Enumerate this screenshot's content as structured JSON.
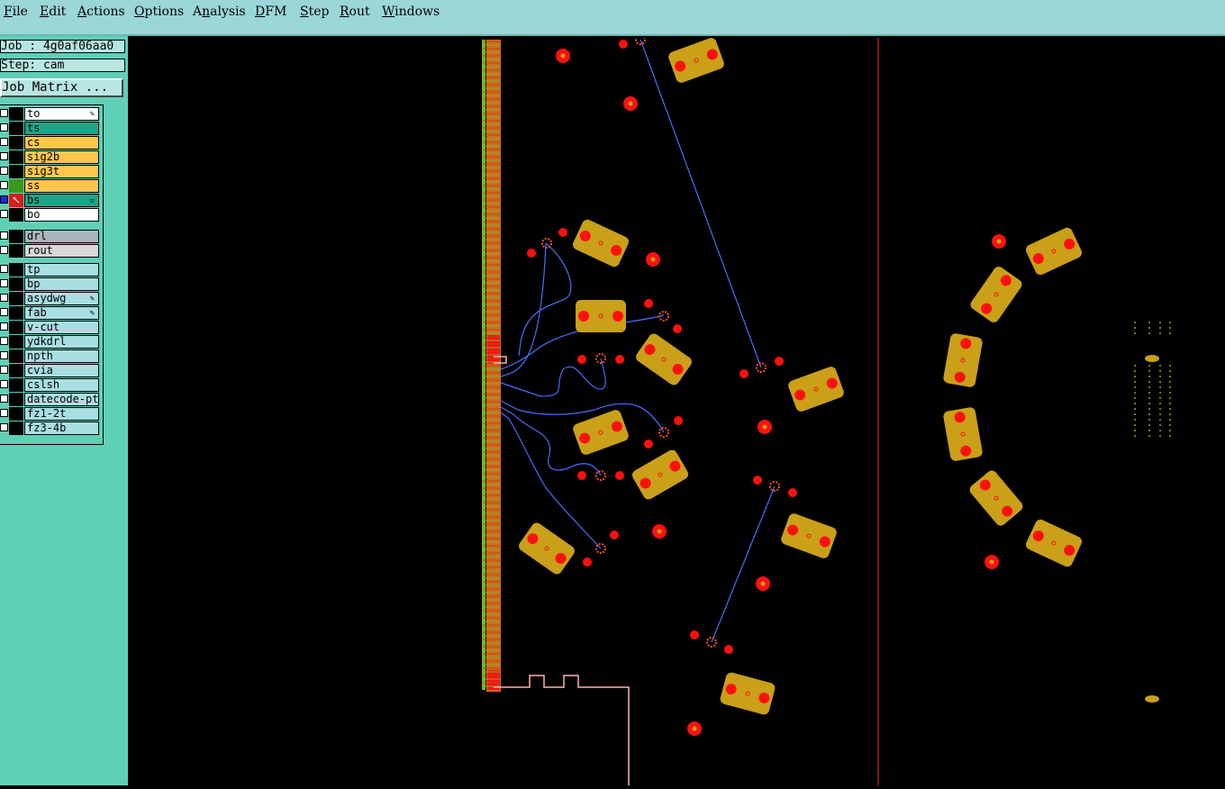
{
  "menu": {
    "items": [
      {
        "label": "File",
        "accel": "F"
      },
      {
        "label": "Edit",
        "accel": "E"
      },
      {
        "label": "Actions",
        "accel": "A"
      },
      {
        "label": "Options",
        "accel": "O"
      },
      {
        "label": "Analysis",
        "accel": "n"
      },
      {
        "label": "DFM",
        "accel": "D"
      },
      {
        "label": "Step",
        "accel": "S"
      },
      {
        "label": "Rout",
        "accel": "R"
      },
      {
        "label": "Windows",
        "accel": "W"
      }
    ]
  },
  "job": {
    "job_text": "Job : 4g0af06aa0",
    "step_text": "Step: cam",
    "matrix_button": "Job Matrix ..."
  },
  "layers": {
    "group1": [
      {
        "name": "to",
        "color": "#ffffff",
        "mark": "✎"
      },
      {
        "name": "ts",
        "color": "#1fa487",
        "mark": ""
      },
      {
        "name": "cs",
        "color": "#ffc64f",
        "mark": ""
      },
      {
        "name": "sig2b",
        "color": "#ffc64f",
        "mark": ""
      },
      {
        "name": "sig3t",
        "color": "#ffc64f",
        "mark": ""
      },
      {
        "name": "ss",
        "color": "#ffc64f",
        "mark": "",
        "indicator": "#3c9a1a"
      },
      {
        "name": "bs",
        "color": "#1fa487",
        "mark": "▫",
        "active": true
      },
      {
        "name": "bo",
        "color": "#ffffff",
        "mark": ""
      }
    ],
    "group2": [
      {
        "name": "drl",
        "color": "#a9b6ba",
        "mark": ""
      },
      {
        "name": "rout",
        "color": "#d8d8d8",
        "mark": ""
      }
    ],
    "group3": [
      {
        "name": "tp",
        "color": "#a8dfe2",
        "mark": ""
      },
      {
        "name": "bp",
        "color": "#a8dfe2",
        "mark": ""
      },
      {
        "name": "asydwg",
        "color": "#a8dfe2",
        "mark": "✎"
      },
      {
        "name": "fab",
        "color": "#a8dfe2",
        "mark": "✎"
      },
      {
        "name": "v-cut",
        "color": "#a8dfe2",
        "mark": ""
      },
      {
        "name": "ydkdrl",
        "color": "#a8dfe2",
        "mark": ""
      },
      {
        "name": "npth",
        "color": "#a8dfe2",
        "mark": ""
      },
      {
        "name": "cvia",
        "color": "#a8dfe2",
        "mark": ""
      },
      {
        "name": "cslsh",
        "color": "#a8dfe2",
        "mark": ""
      },
      {
        "name": "datecode-pt",
        "color": "#a8dfe2",
        "mark": ""
      },
      {
        "name": "fz1-2t",
        "color": "#a8dfe2",
        "mark": ""
      },
      {
        "name": "fz3-4b",
        "color": "#a8dfe2",
        "mark": ""
      }
    ]
  },
  "colors": {
    "pad_red": "#ff1010",
    "pad_gold": "#c9a018",
    "trace_blue": "#4a6cff",
    "outline_white": "#ffffff",
    "outline_red": "#ff3030",
    "connector_orange": "#d46a1a",
    "connector_green": "#78b428"
  }
}
